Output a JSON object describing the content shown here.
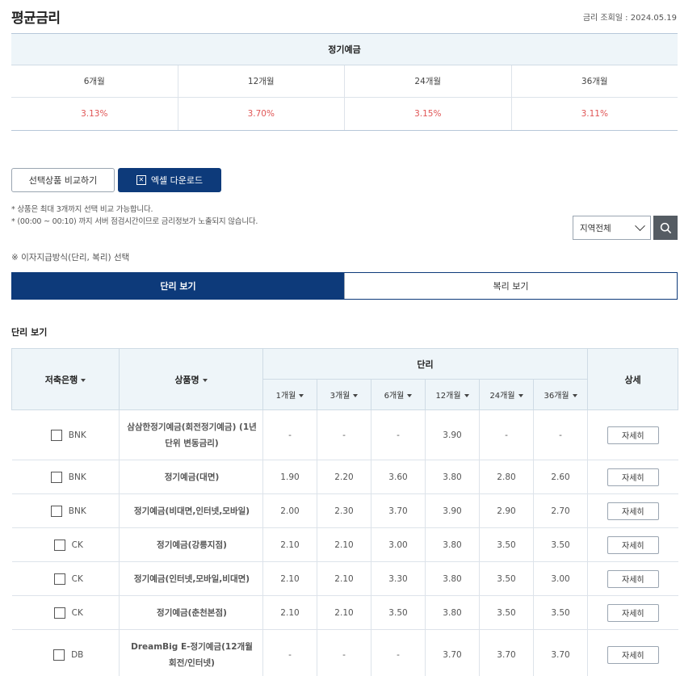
{
  "page": {
    "title": "평균금리",
    "query_date": "금리 조회일 : 2024.05.19"
  },
  "avg_table": {
    "heading": "정기예금",
    "terms": [
      "6개월",
      "12개월",
      "24개월",
      "36개월"
    ],
    "rates": [
      "3.13%",
      "3.70%",
      "3.15%",
      "3.11%"
    ]
  },
  "buttons": {
    "compare": "선택상품 비교하기",
    "excel": "엑셀 다운로드"
  },
  "notes": {
    "line1": "* 상품은 최대 3개까지 선택 비교 가능합니다.",
    "line2": "* (00:00 ~ 00:10) 까지 서버 점검시간이므로 금리정보가 노출되지 않습니다."
  },
  "region": {
    "selected": "지역전체"
  },
  "interest_note": "※ 이자지급방식(단리, 복리) 선택",
  "toggle": {
    "simple": "단리 보기",
    "compound": "복리 보기",
    "active": "simple"
  },
  "section_title": "단리 보기",
  "table": {
    "headers": {
      "bank": "저축은행",
      "product": "상품명",
      "group": "단리",
      "detail": "상세"
    },
    "terms": [
      "1개월",
      "3개월",
      "6개월",
      "12개월",
      "24개월",
      "36개월"
    ],
    "detail_label": "자세히",
    "rows": [
      {
        "bank": "BNK",
        "product": "삼삼한정기예금(회전정기예금) (1년단위 변동금리)",
        "rates": [
          "-",
          "-",
          "-",
          "3.90",
          "-",
          "-"
        ]
      },
      {
        "bank": "BNK",
        "product": "정기예금(대면)",
        "rates": [
          "1.90",
          "2.20",
          "3.60",
          "3.80",
          "2.80",
          "2.60"
        ]
      },
      {
        "bank": "BNK",
        "product": "정기예금(비대면,인터넷,모바일)",
        "rates": [
          "2.00",
          "2.30",
          "3.70",
          "3.90",
          "2.90",
          "2.70"
        ]
      },
      {
        "bank": "CK",
        "product": "정기예금(강릉지점)",
        "rates": [
          "2.10",
          "2.10",
          "3.00",
          "3.80",
          "3.50",
          "3.50"
        ]
      },
      {
        "bank": "CK",
        "product": "정기예금(인터넷,모바일,비대면)",
        "rates": [
          "2.10",
          "2.10",
          "3.30",
          "3.80",
          "3.50",
          "3.00"
        ]
      },
      {
        "bank": "CK",
        "product": "정기예금(춘천본점)",
        "rates": [
          "2.10",
          "2.10",
          "3.50",
          "3.80",
          "3.50",
          "3.50"
        ]
      },
      {
        "bank": "DB",
        "product": "DreamBig E-정기예금(12개월 회전/인터넷)",
        "rates": [
          "-",
          "-",
          "-",
          "3.70",
          "3.70",
          "3.70"
        ]
      }
    ]
  }
}
